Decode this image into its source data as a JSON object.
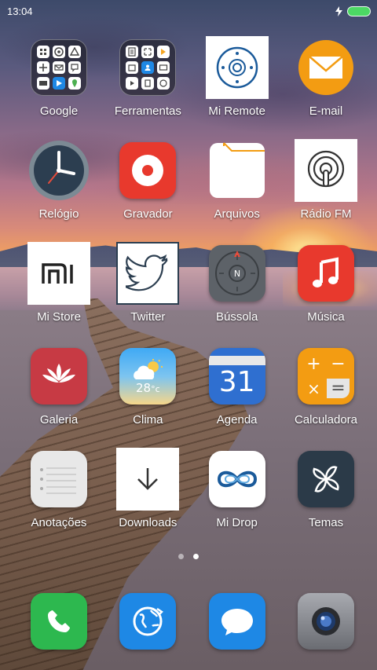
{
  "status_bar": {
    "time": "13:04",
    "battery_color": "#4cd964"
  },
  "apps": [
    {
      "label": "Google",
      "icon": "google-folder-icon"
    },
    {
      "label": "Ferramentas",
      "icon": "tools-folder-icon"
    },
    {
      "label": "Mi Remote",
      "icon": "mi-remote-icon"
    },
    {
      "label": "E-mail",
      "icon": "email-icon"
    },
    {
      "label": "Relógio",
      "icon": "clock-icon"
    },
    {
      "label": "Gravador",
      "icon": "recorder-icon"
    },
    {
      "label": "Arquivos",
      "icon": "files-icon"
    },
    {
      "label": "Rádio FM",
      "icon": "radio-fm-icon"
    },
    {
      "label": "Mi Store",
      "icon": "mi-store-icon"
    },
    {
      "label": "Twitter",
      "icon": "twitter-icon"
    },
    {
      "label": "Bússola",
      "icon": "compass-icon"
    },
    {
      "label": "Música",
      "icon": "music-icon"
    },
    {
      "label": "Galeria",
      "icon": "gallery-icon"
    },
    {
      "label": "Clima",
      "icon": "weather-icon"
    },
    {
      "label": "Agenda",
      "icon": "calendar-icon"
    },
    {
      "label": "Calculadora",
      "icon": "calculator-icon"
    },
    {
      "label": "Anotações",
      "icon": "notes-icon"
    },
    {
      "label": "Downloads",
      "icon": "downloads-icon"
    },
    {
      "label": "Mi Drop",
      "icon": "mi-drop-icon"
    },
    {
      "label": "Temas",
      "icon": "themes-icon"
    }
  ],
  "weather": {
    "temperature": "28",
    "unit": "°c"
  },
  "calendar": {
    "day": "31"
  },
  "calculator": {
    "plus": "+",
    "minus": "−",
    "times": "×",
    "equals": "="
  },
  "mi_store": {
    "logo": "mi"
  },
  "compass": {
    "north": "N"
  },
  "page_indicator": {
    "total": 2,
    "active": 2
  },
  "dock": [
    {
      "icon": "phone-icon",
      "color": "#2db84f"
    },
    {
      "icon": "browser-icon",
      "color": "#1e88e5"
    },
    {
      "icon": "messages-icon",
      "color": "#1e88e5"
    },
    {
      "icon": "camera-icon",
      "color": "#8a8c90"
    }
  ]
}
